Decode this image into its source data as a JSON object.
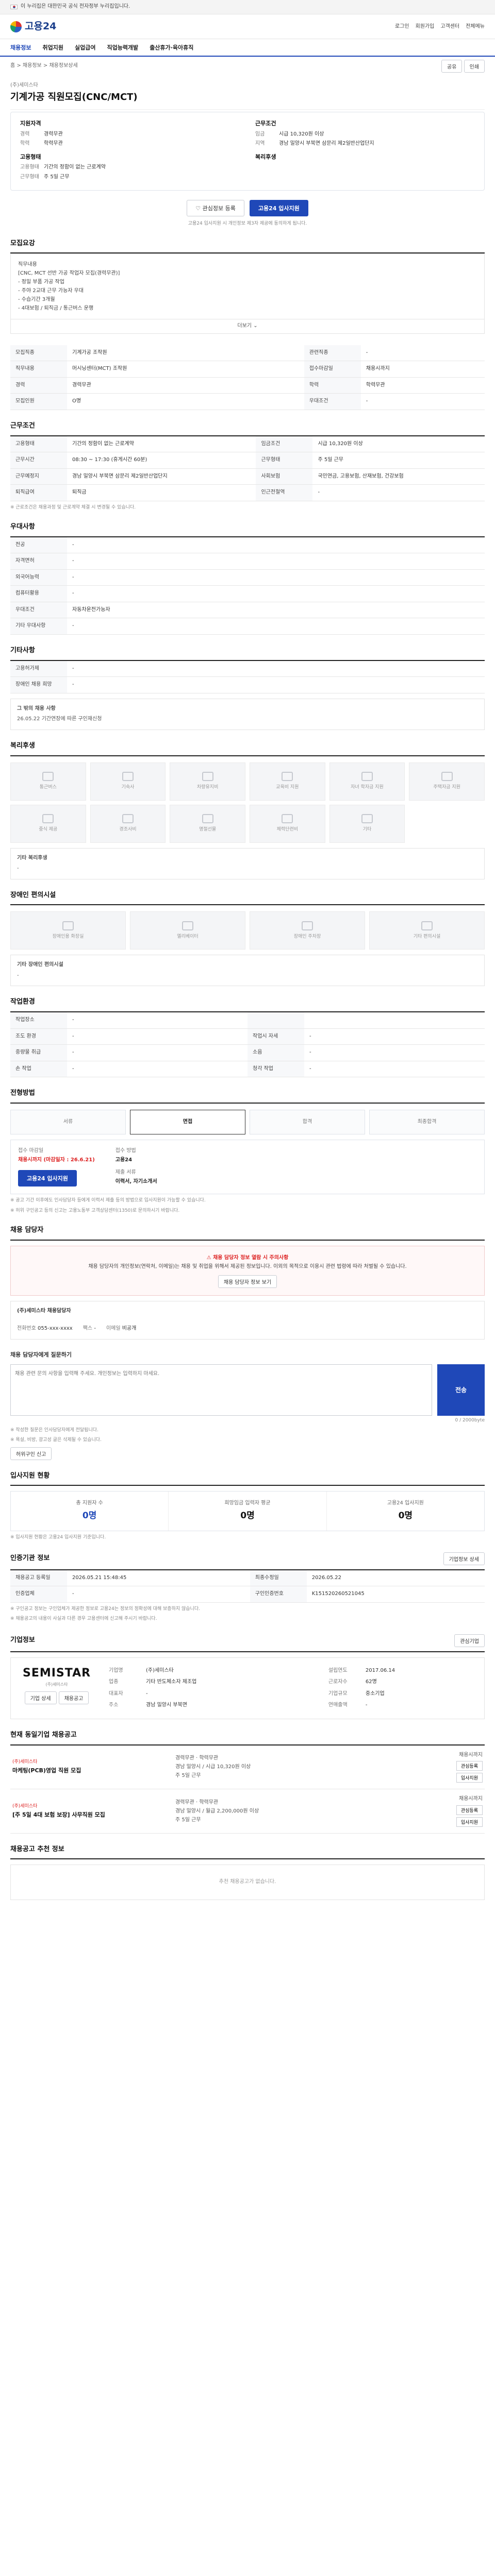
{
  "gov_banner": {
    "text": "이 누리집은 대한민국 공식 전자정부 누리집입니다."
  },
  "header": {
    "logo": "고용24",
    "links": [
      "로그인",
      "회원가입",
      "고객센터",
      "전체메뉴"
    ]
  },
  "menu": [
    "채용정보",
    "취업지원",
    "실업급여",
    "직업능력개발",
    "출산휴가·육아휴직"
  ],
  "page": {
    "company": "(주)세미스타",
    "title": "기계가공 직원모집(CNC/MCT)",
    "breadcrumb": "홈 > 채용정보 > 채용정보상세",
    "share": "공유",
    "print": "인쇄"
  },
  "summary": {
    "left_title": "지원자격",
    "left": [
      {
        "k": "경력",
        "v": "경력무관"
      },
      {
        "k": "학력",
        "v": "학력무관"
      }
    ],
    "left_title2": "고용형태",
    "left2": [
      {
        "k": "고용형태",
        "v": "기간의 정함이 없는 근로계약"
      },
      {
        "k": "근무형태",
        "v": "주 5일 근무"
      }
    ],
    "right_title": "근무조건",
    "right": [
      {
        "k": "임금",
        "v": "시급 10,320원 이상"
      },
      {
        "k": "지역",
        "v": "경남 밀양시 부북면 삼문리 제2일반산업단지"
      }
    ],
    "right_title2": "복리후생",
    "right2": []
  },
  "actions": {
    "interest": "관심정보 등록",
    "apply": "고용24 입사지원"
  },
  "actions_note": "고용24 입사지원 시 개인정보 제3자 제공에 동의하게 됩니다.",
  "job_content": {
    "heading": "모집요강",
    "text": [
      "직무내용",
      "[CNC, MCT 선반 가공 작업자 모집(경력무관)]",
      "- 정밀 부품 가공 작업",
      "- 주야 2교대 근무 가능자 우대",
      "- 수습기간 3개월",
      "- 4대보험 / 퇴직금 / 통근버스 운행"
    ],
    "more": "더보기"
  },
  "recruit": {
    "heading": "모집요강",
    "rows": [
      {
        "k": "모집직종",
        "v": "기계가공 조작원",
        "k2": "관련직종",
        "v2": "-"
      },
      {
        "k": "직무내용",
        "v": "머시닝센터(MCT) 조작원",
        "k2": "접수마감일",
        "v2": "채용시까지"
      },
      {
        "k": "경력",
        "v": "경력무관",
        "k2": "학력",
        "v2": "학력무관"
      },
      {
        "k": "모집인원",
        "v": "O명",
        "k2": "우대조건",
        "v2": "-"
      }
    ]
  },
  "conditions": {
    "heading": "근무조건",
    "rows": [
      {
        "k": "고용형태",
        "v": "기간의 정함이 없는 근로계약",
        "k2": "임금조건",
        "v2": "시급 10,320원 이상"
      },
      {
        "k": "근무시간",
        "v": "08:30 ~ 17:30 (휴게시간 60분)",
        "k2": "근무형태",
        "v2": "주 5일 근무"
      },
      {
        "k": "근무예정지",
        "v": "경남 밀양시 부북면 삼문리 제2일반산업단지",
        "k2": "사회보험",
        "v2": "국민연금, 고용보험, 산재보험, 건강보험"
      },
      {
        "k": "퇴직급여",
        "v": "퇴직금",
        "k2": "인근전철역",
        "v2": "-"
      }
    ],
    "note": "※ 근로조건은 채용과정 및 근로계약 체결 시 변경될 수 있습니다."
  },
  "qualification": {
    "heading": "우대사항",
    "rows": [
      {
        "k": "전공",
        "v": "-"
      },
      {
        "k": "자격면허",
        "v": "-"
      },
      {
        "k": "외국어능력",
        "v": "-"
      },
      {
        "k": "컴퓨터활용",
        "v": "-"
      },
      {
        "k": "우대조건",
        "v": "자동차운전가능자"
      },
      {
        "k": "기타 우대사항",
        "v": "-"
      }
    ]
  },
  "process": {
    "heading": "기타사항",
    "rows": [
      {
        "k": "고용허가제",
        "v": "-"
      },
      {
        "k": "장애인 채용 희망",
        "v": "-"
      }
    ],
    "box_title": "그 밖의 채용 사항",
    "box_text": "26.05.22 기간연장에 따른 구인재신청"
  },
  "welfare": {
    "heading": "복리후생",
    "items": [
      "통근버스",
      "기숙사",
      "차량유지비",
      "교육비 지원",
      "자녀 학자금 지원",
      "주택자금 지원",
      "중식 제공",
      "경조사비",
      "명절선물",
      "체력단련비",
      "기타"
    ],
    "box_title": "기타 복리후생",
    "box_text": "-"
  },
  "disabled": {
    "heading": "장애인 편의시설",
    "items": [
      "장애인용 화장실",
      "엘리베이터",
      "장애인 주차장",
      "기타 편의시설"
    ],
    "box_title": "기타 장애인 편의시설",
    "box_text": "-"
  },
  "workenv": {
    "heading": "작업환경",
    "rows": [
      {
        "k": "작업장소",
        "v": "-",
        "k2": "",
        "v2": ""
      },
      {
        "k": "조도 환경",
        "v": "-",
        "k2": "작업시 자세",
        "v2": "-"
      },
      {
        "k": "중량물 취급",
        "v": "-",
        "k2": "소음",
        "v2": "-"
      },
      {
        "k": "손 작업",
        "v": "-",
        "k2": "청각 작업",
        "v2": "-"
      }
    ]
  },
  "steps": {
    "heading": "전형방법",
    "items": [
      "서류",
      "면접",
      "합격",
      "최종합격"
    ]
  },
  "apply": {
    "deadline_t": "접수 마감일",
    "deadline": "채용시까지 (마감일자 : 26.6.21)",
    "method_t": "접수 방법",
    "method": "고용24",
    "docs_t": "제출 서류",
    "docs": "이력서, 자기소개서",
    "button": "고용24 입사지원"
  },
  "apply_notes": [
    "※ 공고 기간 이후에도 인사담당자 등에게 이력서 제출 등의 방법으로 입사지원이 가능할 수 있습니다.",
    "※ 허위 구인공고 등의 신고는 고용노동부 고객상담센터(1350)로 문의하시기 바랍니다."
  ],
  "contact": {
    "heading": "채용 담당자",
    "notice_title": "채용 담당자 정보 열람 시 주의사항",
    "notice_text": "채용 담당자의 개인정보(연락처, 이메일)는 채용 및 취업을 위해서 제공된 정보입니다. 이외의 목적으로 이용시 관련 법령에 따라 처벌될 수 있습니다.",
    "notice_button": "채용 담당자 정보 보기",
    "name": "(주)세미스타 채용담당자",
    "phone_t": "전화번호",
    "phone": "055-xxx-xxxx",
    "fax_t": "팩스",
    "fax": "-",
    "email_t": "이메일",
    "email": "비공개"
  },
  "inquiry": {
    "heading": "채용 담당자에게 질문하기",
    "placeholder": "채용 관련 문의 사항을 입력해 주세요. 개인정보는 입력하지 마세요.",
    "send": "전송",
    "count": "0 / 2000byte",
    "notes": [
      "※ 작성한 질문은 인사담당자에게 전달됩니다.",
      "※ 욕설, 비방, 광고성 글은 삭제될 수 있습니다."
    ],
    "report_button": "허위구인 신고"
  },
  "stats": {
    "heading": "입사지원 현황",
    "items": [
      {
        "t": "총 지원자 수",
        "n": "0명",
        "blue": true
      },
      {
        "t": "희망임금 입력자 평균",
        "n": "0명",
        "blue": false
      },
      {
        "t": "고용24 입사지원",
        "n": "0명",
        "blue": false
      }
    ],
    "note": "※ 입사지원 현황은 고용24 입사지원 기준입니다."
  },
  "info": {
    "heading": "인증기관 정보",
    "button": "기업정보 상세",
    "rows": [
      {
        "k": "채용공고 등록일",
        "v": "2026.05.21 15:48:45",
        "k2": "최종수정일",
        "v2": "2026.05.22"
      },
      {
        "k": "인증업체",
        "v": "-",
        "k2": "구인인증번호",
        "v2": "K151520260521045"
      }
    ],
    "notes": [
      "※ 구인공고 정보는 구인업체가 제공한 정보로 고용24는 정보의 정확성에 대해 보증하지 않습니다.",
      "※ 채용공고의 내용이 사실과 다른 경우 고용센터에 신고해 주시기 바랍니다."
    ]
  },
  "corp": {
    "heading": "기업정보",
    "logo_name": "SEMISTAR",
    "logo_sub": "(주)세미스타",
    "btn1": "기업 상세",
    "btn2": "채용공고",
    "rows": [
      {
        "k": "기업명",
        "v": "(주)세미스타",
        "k2": "설립연도",
        "v2": "2017.06.14"
      },
      {
        "k": "업종",
        "v": "기타 반도체소자 제조업",
        "k2": "근로자수",
        "v2": "62명"
      },
      {
        "k": "대표자",
        "v": "-",
        "k2": "기업규모",
        "v2": "중소기업"
      },
      {
        "k": "주소",
        "v": "경남 밀양시 부북면",
        "k2": "연매출액",
        "v2": "-"
      }
    ],
    "interest": "관심기업"
  },
  "other_jobs": {
    "heading": "현재 동일기업 채용공고",
    "items": [
      {
        "company": "(주)세미스타",
        "title": "마케팅(PCB)영업 직원 모집",
        "info1": "경력무관 · 학력무관",
        "info2": "경남 밀양시 / 시급 10,320원 이상",
        "info3": "주 5일 근무",
        "deadline": "채용시까지",
        "b1": "관심등록",
        "b2": "입사지원"
      },
      {
        "company": "(주)세미스타",
        "title": "[주 5일 4대 보험 보장] 사무직원 모집",
        "info1": "경력무관 · 학력무관",
        "info2": "경남 밀양시 / 월급 2,200,000원 이상",
        "info3": "주 5일 근무",
        "deadline": "채용시까지",
        "b1": "관심등록",
        "b2": "입사지원"
      }
    ]
  },
  "recent": {
    "heading": "채용공고 추천 정보",
    "empty": "추천 채용공고가 없습니다."
  }
}
